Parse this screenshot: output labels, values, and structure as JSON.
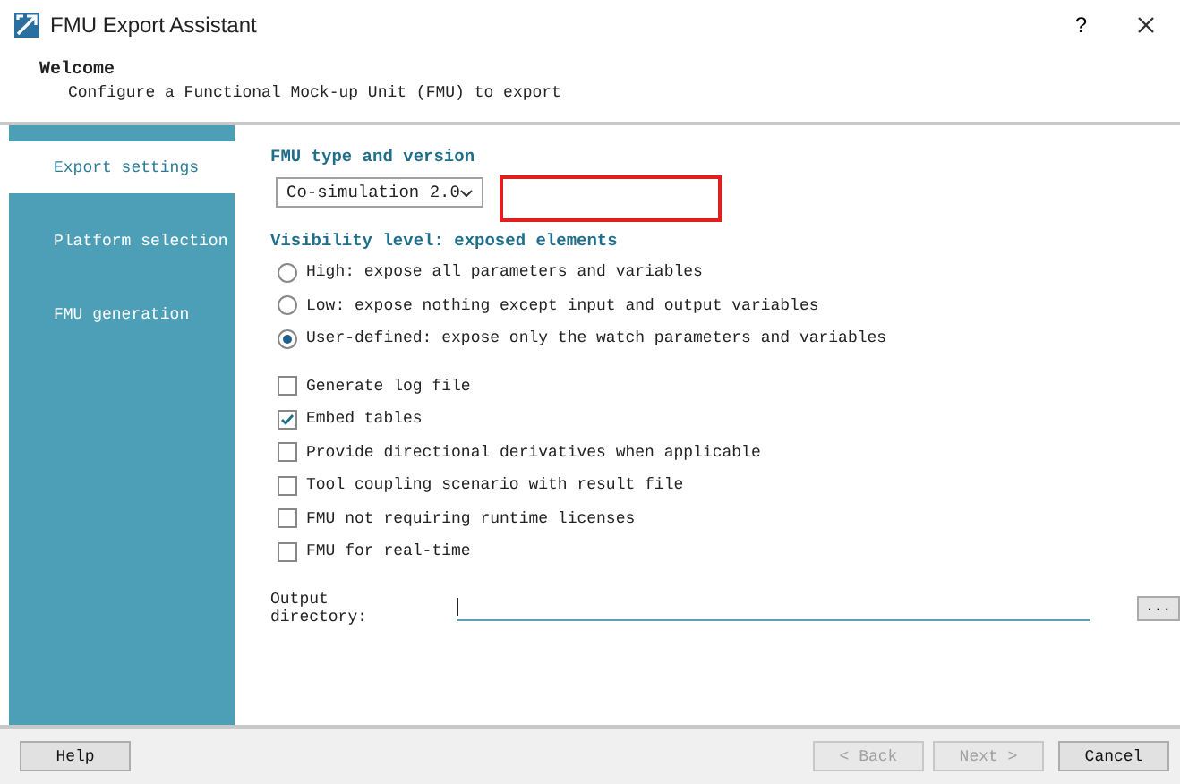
{
  "window": {
    "title": "FMU Export Assistant",
    "help": "?"
  },
  "header": {
    "title": "Welcome",
    "subtitle": "Configure a Functional Mock-up Unit (FMU) to export"
  },
  "sidebar": {
    "items": [
      {
        "label": "Export settings",
        "selected": true
      },
      {
        "label": "Platform selection",
        "selected": false
      },
      {
        "label": "FMU generation",
        "selected": false
      }
    ]
  },
  "fmu_type": {
    "heading": "FMU type and version",
    "value": "Co-simulation 2.0"
  },
  "visibility": {
    "heading": "Visibility level: exposed elements",
    "options": [
      {
        "label": "High: expose all parameters and variables",
        "selected": false
      },
      {
        "label": "Low: expose nothing except input and output variables",
        "selected": false
      },
      {
        "label": "User-defined: expose only the watch parameters and variables",
        "selected": true
      }
    ]
  },
  "options": [
    {
      "label": "Generate log file",
      "checked": false
    },
    {
      "label": "Embed tables",
      "checked": true
    },
    {
      "label": "Provide directional derivatives when applicable",
      "checked": false
    },
    {
      "label": "Tool coupling scenario with result file",
      "checked": false
    },
    {
      "label": "FMU not requiring runtime licenses",
      "checked": false
    },
    {
      "label": "FMU for real-time",
      "checked": false
    }
  ],
  "output_directory": {
    "label": "Output directory:",
    "browse": "..."
  },
  "buttons": [
    {
      "label": "Help",
      "disabled": false,
      "kind": "left"
    },
    {
      "label": "< Back",
      "disabled": true,
      "kind": "right"
    },
    {
      "label": "Next >",
      "disabled": true,
      "kind": "right"
    },
    {
      "label": "Cancel",
      "disabled": false,
      "kind": "right"
    }
  ]
}
